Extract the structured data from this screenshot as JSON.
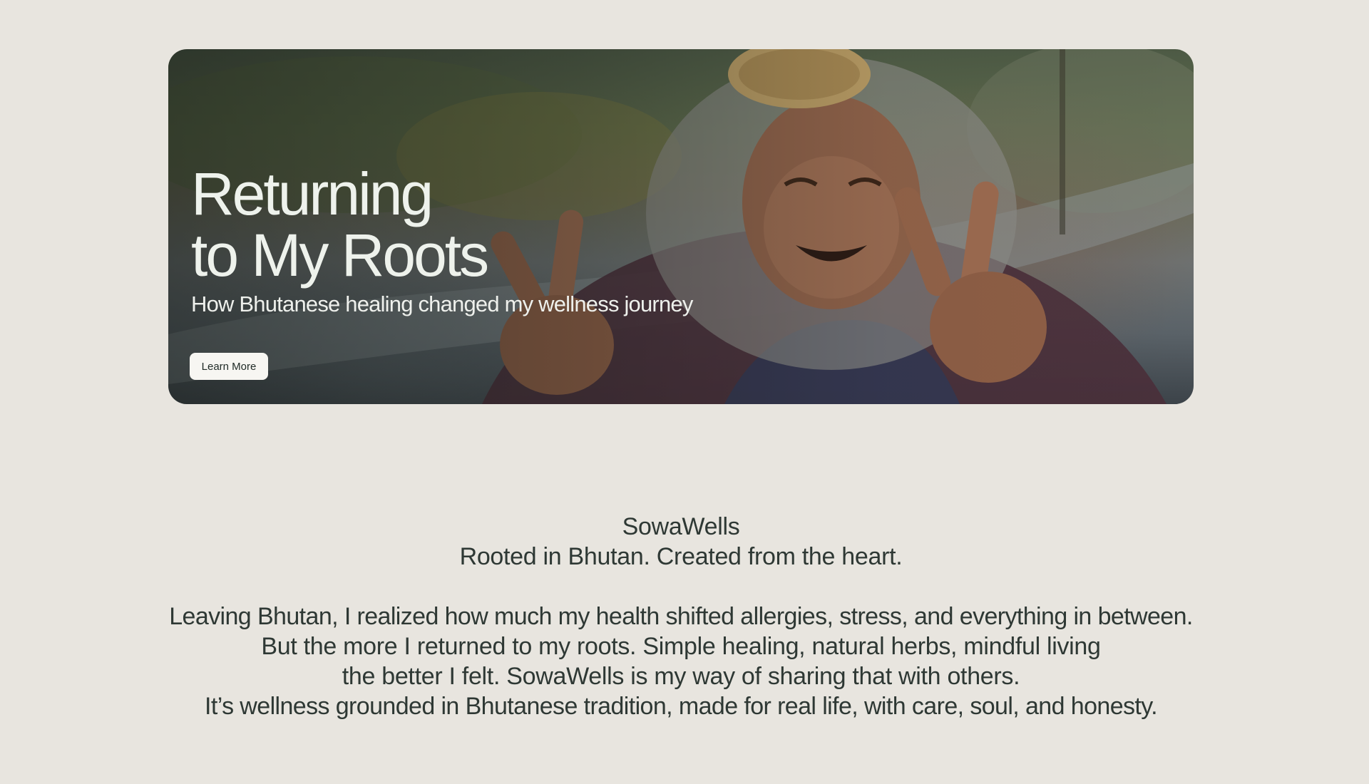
{
  "hero": {
    "title_line1": "Returning",
    "title_line2": "to My Roots",
    "subtitle": "How Bhutanese healing changed my wellness journey",
    "button_label": "Learn More"
  },
  "about": {
    "brand": "SowaWells",
    "tagline": "Rooted in Bhutan. Created from the heart.",
    "paragraph_lines": [
      "Leaving Bhutan, I realized how much my health shifted allergies, stress, and everything in between.",
      "But the more I returned to my roots. Simple healing, natural herbs, mindful living",
      "the better I felt. SowaWells is my way of sharing that with others.",
      "It’s wellness grounded in Bhutanese tradition, made for real life, with care, soul, and honesty."
    ]
  },
  "colors": {
    "page_background": "#e8e5df",
    "text": "#2e3834",
    "hero_text": "#eef2ec",
    "button_background": "#f7f6f2"
  }
}
